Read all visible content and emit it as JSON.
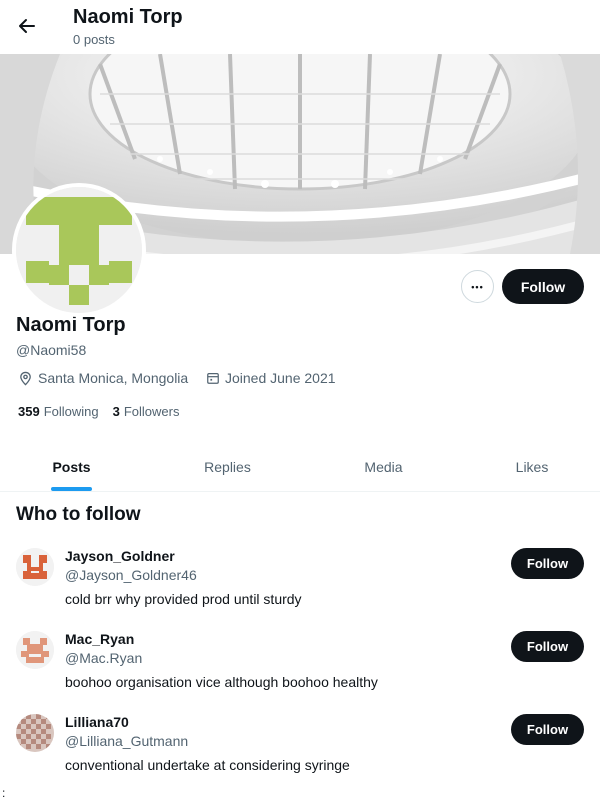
{
  "header": {
    "title": "Naomi Torp",
    "subtitle": "0 posts",
    "back_icon": "arrow-left-icon"
  },
  "profile": {
    "name": "Naomi Torp",
    "handle": "@Naomi58",
    "location": "Santa Monica, Mongolia",
    "joined": "Joined June 2021",
    "following_count": "359",
    "following_label": "Following",
    "followers_count": "3",
    "followers_label": "Followers",
    "follow_label": "Follow",
    "more_label": "•••",
    "avatar_color": "#a9c75a"
  },
  "tabs": [
    {
      "label": "Posts",
      "active": true
    },
    {
      "label": "Replies",
      "active": false
    },
    {
      "label": "Media",
      "active": false
    },
    {
      "label": "Likes",
      "active": false
    }
  ],
  "who_to_follow": {
    "title": "Who to follow",
    "users": [
      {
        "name": "Jayson_Goldner",
        "handle": "@Jayson_Goldner46",
        "bio": "cold brr why provided prod until sturdy",
        "follow_label": "Follow",
        "color": "#d9623a"
      },
      {
        "name": "Mac_Ryan",
        "handle": "@Mac.Ryan",
        "bio": "boohoo organisation vice although boohoo healthy",
        "follow_label": "Follow",
        "color": "#e0967a"
      },
      {
        "name": "Lilliana70",
        "handle": "@Lilliana_Gutmann",
        "bio": "conventional undertake at considering syringe",
        "follow_label": "Follow",
        "color": "#b58a7e"
      }
    ]
  },
  "footer": {
    "mark": ":"
  },
  "colors": {
    "accent": "#1d9bf0",
    "button_dark": "#0f1419",
    "muted": "#536471"
  }
}
